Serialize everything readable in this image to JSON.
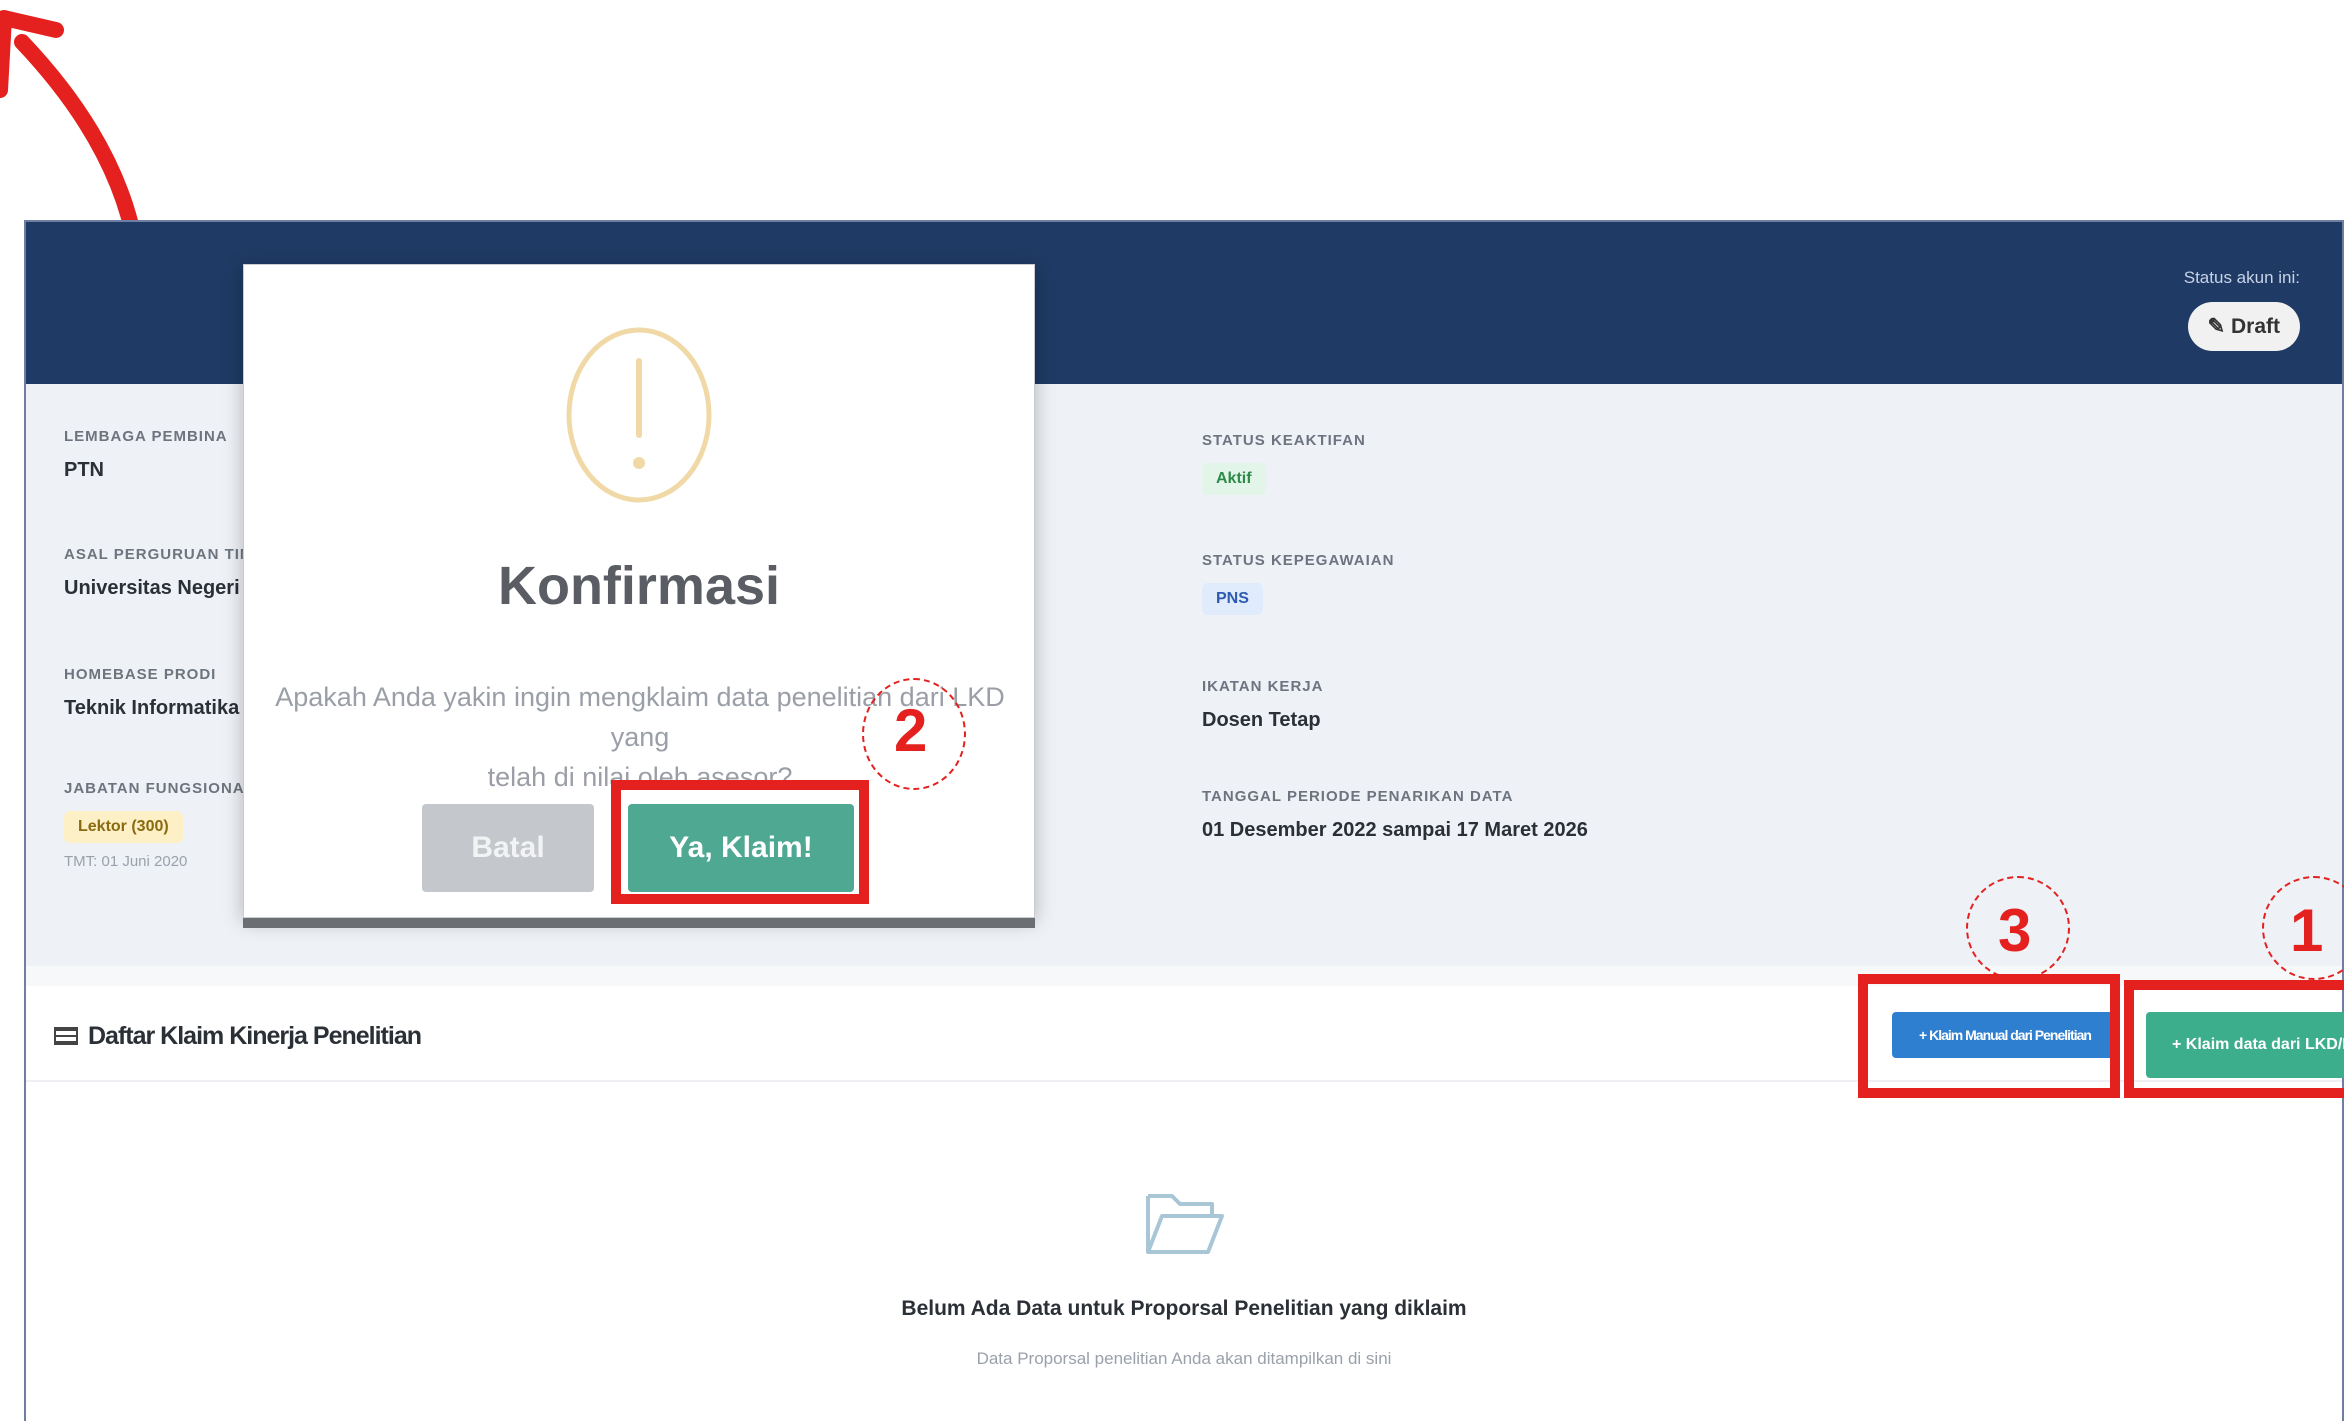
{
  "header": {
    "status_label": "Status akun ini:",
    "status_value": "Draft"
  },
  "profile": {
    "left": [
      {
        "label": "LEMBAGA PEMBINA",
        "value": "PTN"
      },
      {
        "label": "ASAL PERGURUAN TINGGI",
        "value": "Universitas Negeri"
      },
      {
        "label": "HOMEBASE PRODI",
        "value": "Teknik Informatika"
      }
    ],
    "jabatan": {
      "label": "JABATAN FUNGSIONAL",
      "badge": "Lektor (300)",
      "tmt": "TMT: 01 Juni 2020"
    },
    "right": [
      {
        "label": "STATUS KEAKTIFAN",
        "badge": "Aktif"
      },
      {
        "label": "STATUS KEPEGAWAIAN",
        "badge": "PNS"
      },
      {
        "label": "IKATAN KERJA",
        "value": "Dosen Tetap"
      },
      {
        "label": "TANGGAL PERIODE PENARIKAN DATA",
        "value": "01 Desember 2022 sampai 17 Maret 2026"
      }
    ]
  },
  "section": {
    "title": "Daftar Klaim Kinerja Penelitian",
    "btn_manual": "+ Klaim Manual dari Penelitian",
    "btn_sister": "+ Klaim data dari LKD/BKD",
    "empty_title": "Belum Ada Data untuk Proporsal Penelitian yang diklaim",
    "empty_sub": "Data Proporsal penelitian Anda akan ditampilkan di sini"
  },
  "modal": {
    "title": "Konfirmasi",
    "line1": "Apakah Anda yakin ingin mengklaim data penelitian dari LKD yang",
    "line2": "telah di nilai oleh asesor?",
    "cancel": "Batal",
    "confirm": "Ya, Klaim!"
  },
  "annotations": {
    "one": "1",
    "two": "2",
    "three": "3"
  },
  "colors": {
    "header_bg": "#1f3a64",
    "confirm_green": "#4fa892",
    "annotation_red": "#e4211e",
    "manual_blue": "#2f7fd0"
  }
}
